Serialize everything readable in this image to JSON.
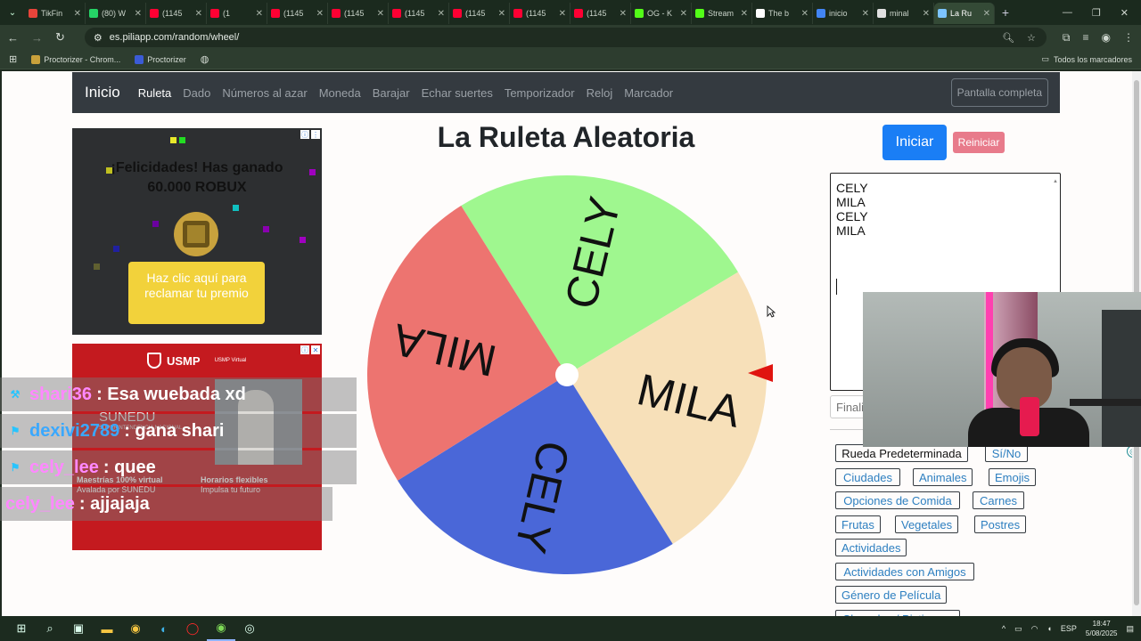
{
  "browser": {
    "tabs": [
      {
        "label": "TikFin",
        "color": "#e8443a"
      },
      {
        "label": "(80) W",
        "color": "#25d366"
      },
      {
        "label": "(1145",
        "color": "#ff0033"
      },
      {
        "label": "(1",
        "color": "#ff0033"
      },
      {
        "label": "(1145",
        "color": "#ff0033"
      },
      {
        "label": "(1145",
        "color": "#ff0033"
      },
      {
        "label": "(1145",
        "color": "#ff0033"
      },
      {
        "label": "(1145",
        "color": "#ff0033"
      },
      {
        "label": "(1145",
        "color": "#ff0033"
      },
      {
        "label": "(1145",
        "color": "#ff0033"
      },
      {
        "label": "OG - K",
        "color": "#53fc18"
      },
      {
        "label": "Stream",
        "color": "#53fc18"
      },
      {
        "label": "The b",
        "color": "#ffffff"
      },
      {
        "label": "inicio",
        "color": "#4285f4"
      },
      {
        "label": "minal",
        "color": "#e0e0e0"
      },
      {
        "label": "La Ru",
        "color": "#7cc4ff"
      }
    ],
    "url": "es.piliapp.com/random/wheel/",
    "bookmarks": [
      {
        "label": "Proctorizer - Chrom...",
        "color": "#c9a13b"
      },
      {
        "label": "Proctorizer",
        "color": "#3b5bd6"
      }
    ],
    "all_bookmarks": "Todos los marcadores"
  },
  "nav": {
    "brand": "Inicio",
    "links": [
      "Ruleta",
      "Dado",
      "Números al azar",
      "Moneda",
      "Barajar",
      "Echar suertes",
      "Temporizador",
      "Reloj",
      "Marcador"
    ],
    "fullscreen": "Pantalla completa"
  },
  "ad1": {
    "headline_1": "¡Felicidades! Has ganado",
    "headline_2": "60.000 ROBUX",
    "cta": "Haz clic aquí para reclamar tu premio"
  },
  "ad2": {
    "brand": "USMP",
    "brand_sub": "USMP Virtual",
    "sunedu": "SUNEDU",
    "sunedu_sub": "SUPERINTENDENCIA NACIONAL",
    "feature_1": "Maestrías 100% virtual",
    "feature_1_sub": "Avalada por SUNEDU",
    "feature_2": "Horarios flexibles",
    "feature_2_sub": "Impulsa tu futuro"
  },
  "title": "La Ruleta Aleatoria",
  "wheel": {
    "segments": [
      {
        "label": "CELY",
        "color": "#9ff78f"
      },
      {
        "label": "MILA",
        "color": "#f7e0b9"
      },
      {
        "label": "CELY",
        "color": "#4a67d8"
      },
      {
        "label": "MILA",
        "color": "#ed7470"
      }
    ]
  },
  "buttons": {
    "start": "Iniciar",
    "reset": "Reiniciar"
  },
  "entries": {
    "lines": [
      "CELY",
      "MILA",
      "CELY",
      "MILA"
    ],
    "finalize_placeholder": "Finaliza"
  },
  "presets": [
    "Rueda Predeterminada",
    "Sí/No",
    "Ciudades",
    "Animales",
    "Emojis",
    "Opciones de Comida",
    "Carnes",
    "Frutas",
    "Vegetales",
    "Postres",
    "Actividades",
    "Actividades con Amigos",
    "Género de Película",
    "Charadas / Pictionary"
  ],
  "chat": [
    {
      "user": "shari36",
      "message": ": Esa wuebada xd"
    },
    {
      "user": "dexivi2789",
      "message": ": gana shari"
    },
    {
      "user": "cely_lee",
      "message": ": quee"
    },
    {
      "user": "cely_lee",
      "message": ": ajjajaja"
    }
  ],
  "taskbar": {
    "lang": "ESP",
    "time": "18:47",
    "date": "5/08/2025"
  }
}
